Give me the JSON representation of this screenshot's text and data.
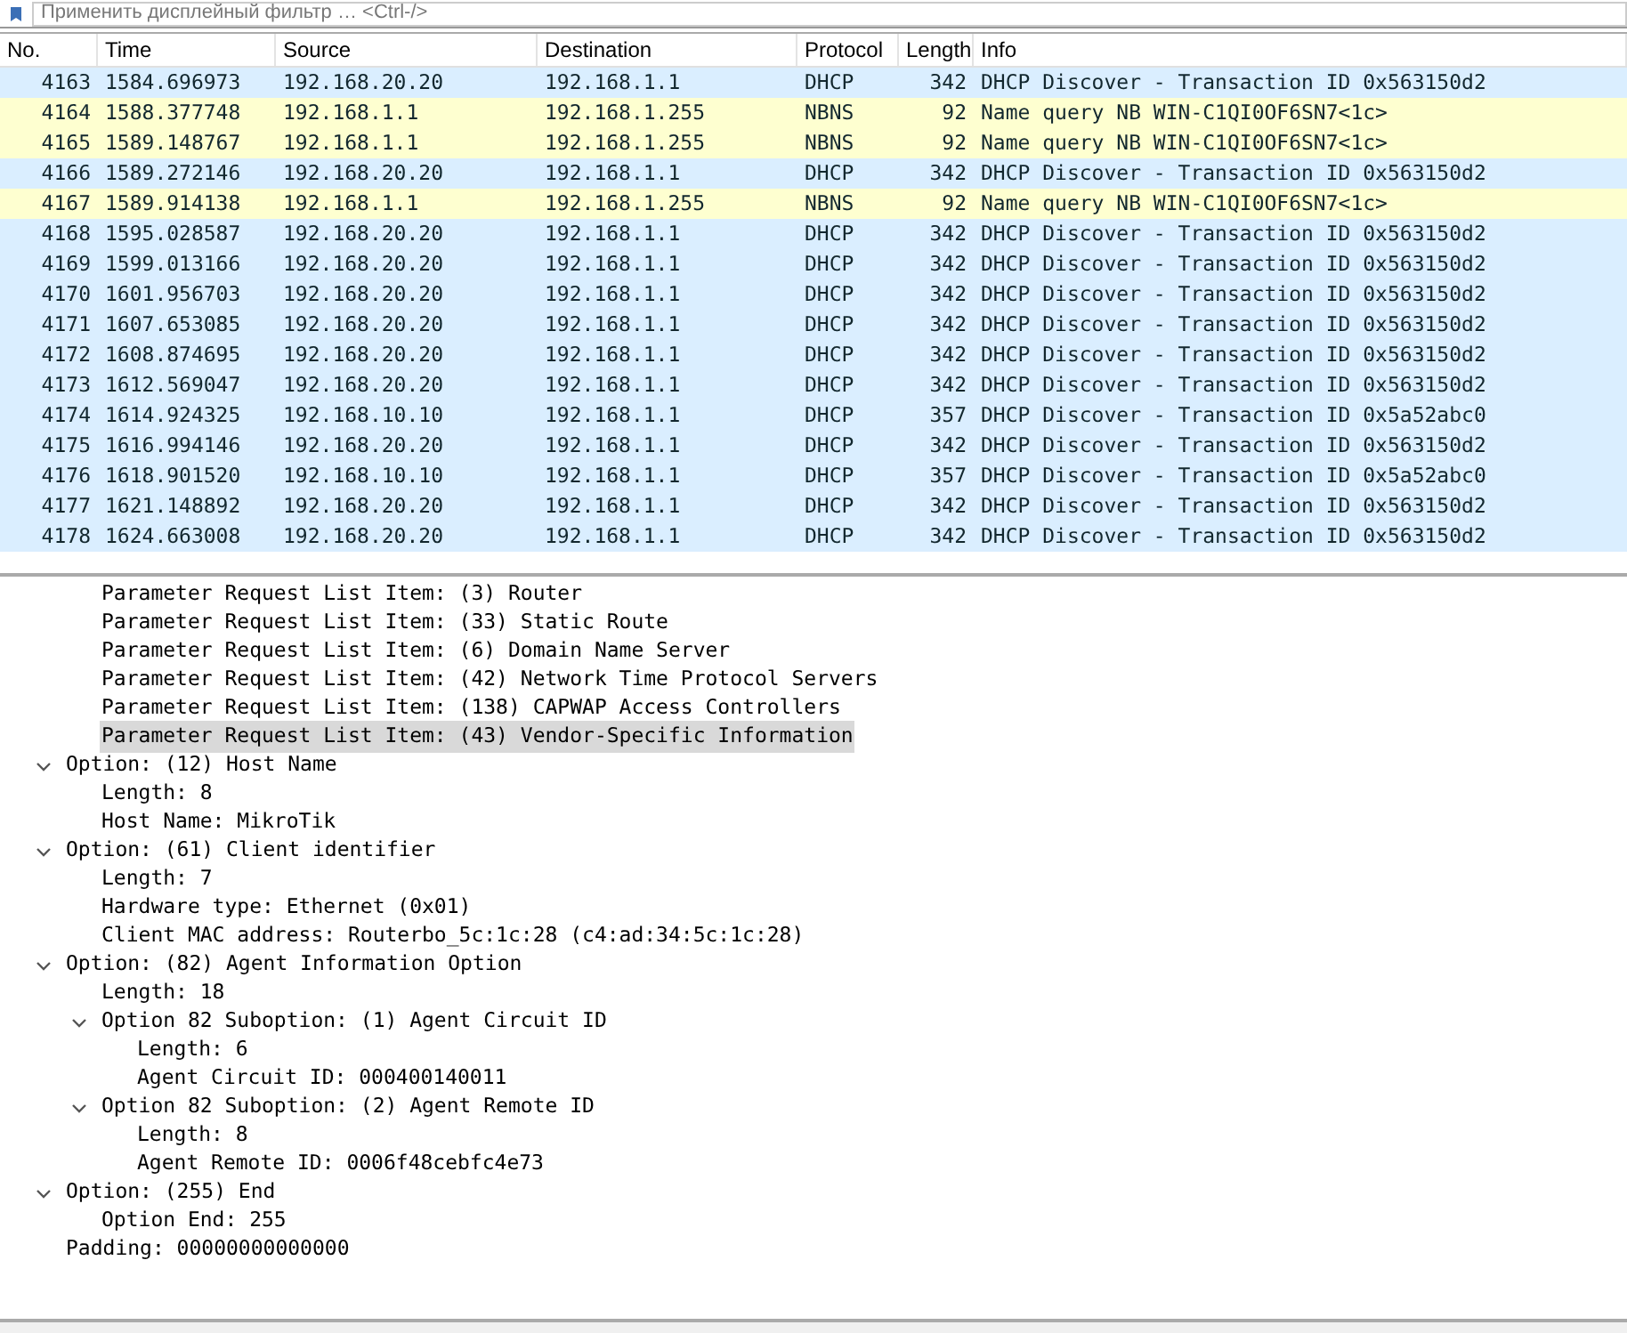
{
  "filter_bar": {
    "placeholder": "Применить дисплейный фильтр … <Ctrl-/>"
  },
  "packet_list": {
    "columns": [
      "No.",
      "Time",
      "Source",
      "Destination",
      "Protocol",
      "Length",
      "Info"
    ],
    "rows": [
      {
        "cells": [
          "4163",
          "1584.696973",
          "192.168.20.20",
          "192.168.1.1",
          "DHCP",
          "342",
          "DHCP Discover - Transaction ID 0x563150d2"
        ],
        "color": "#daeeff"
      },
      {
        "cells": [
          "4164",
          "1588.377748",
          "192.168.1.1",
          "192.168.1.255",
          "NBNS",
          "92",
          "Name query NB WIN-C1QI0OF6SN7<1c>"
        ],
        "color": "#feffd0"
      },
      {
        "cells": [
          "4165",
          "1589.148767",
          "192.168.1.1",
          "192.168.1.255",
          "NBNS",
          "92",
          "Name query NB WIN-C1QI0OF6SN7<1c>"
        ],
        "color": "#feffd0"
      },
      {
        "cells": [
          "4166",
          "1589.272146",
          "192.168.20.20",
          "192.168.1.1",
          "DHCP",
          "342",
          "DHCP Discover - Transaction ID 0x563150d2"
        ],
        "color": "#daeeff"
      },
      {
        "cells": [
          "4167",
          "1589.914138",
          "192.168.1.1",
          "192.168.1.255",
          "NBNS",
          "92",
          "Name query NB WIN-C1QI0OF6SN7<1c>"
        ],
        "color": "#feffd0"
      },
      {
        "cells": [
          "4168",
          "1595.028587",
          "192.168.20.20",
          "192.168.1.1",
          "DHCP",
          "342",
          "DHCP Discover - Transaction ID 0x563150d2"
        ],
        "color": "#daeeff"
      },
      {
        "cells": [
          "4169",
          "1599.013166",
          "192.168.20.20",
          "192.168.1.1",
          "DHCP",
          "342",
          "DHCP Discover - Transaction ID 0x563150d2"
        ],
        "color": "#daeeff"
      },
      {
        "cells": [
          "4170",
          "1601.956703",
          "192.168.20.20",
          "192.168.1.1",
          "DHCP",
          "342",
          "DHCP Discover - Transaction ID 0x563150d2"
        ],
        "color": "#daeeff"
      },
      {
        "cells": [
          "4171",
          "1607.653085",
          "192.168.20.20",
          "192.168.1.1",
          "DHCP",
          "342",
          "DHCP Discover - Transaction ID 0x563150d2"
        ],
        "color": "#daeeff"
      },
      {
        "cells": [
          "4172",
          "1608.874695",
          "192.168.20.20",
          "192.168.1.1",
          "DHCP",
          "342",
          "DHCP Discover - Transaction ID 0x563150d2"
        ],
        "color": "#daeeff"
      },
      {
        "cells": [
          "4173",
          "1612.569047",
          "192.168.20.20",
          "192.168.1.1",
          "DHCP",
          "342",
          "DHCP Discover - Transaction ID 0x563150d2"
        ],
        "color": "#daeeff"
      },
      {
        "cells": [
          "4174",
          "1614.924325",
          "192.168.10.10",
          "192.168.1.1",
          "DHCP",
          "357",
          "DHCP Discover - Transaction ID 0x5a52abc0"
        ],
        "color": "#daeeff"
      },
      {
        "cells": [
          "4175",
          "1616.994146",
          "192.168.20.20",
          "192.168.1.1",
          "DHCP",
          "342",
          "DHCP Discover - Transaction ID 0x563150d2"
        ],
        "color": "#daeeff"
      },
      {
        "cells": [
          "4176",
          "1618.901520",
          "192.168.10.10",
          "192.168.1.1",
          "DHCP",
          "357",
          "DHCP Discover - Transaction ID 0x5a52abc0"
        ],
        "color": "#daeeff"
      },
      {
        "cells": [
          "4177",
          "1621.148892",
          "192.168.20.20",
          "192.168.1.1",
          "DHCP",
          "342",
          "DHCP Discover - Transaction ID 0x563150d2"
        ],
        "color": "#daeeff"
      },
      {
        "cells": [
          "4178",
          "1624.663008",
          "192.168.20.20",
          "192.168.1.1",
          "DHCP",
          "342",
          "DHCP Discover - Transaction ID 0x563150d2"
        ],
        "color": "#daeeff"
      }
    ]
  },
  "details": [
    {
      "expanded": true,
      "children": [
        {
          "label": "Parameter Request List Item: (3) Router",
          "selected": false
        },
        {
          "label": "Parameter Request List Item: (33) Static Route",
          "selected": false
        },
        {
          "label": "Parameter Request List Item: (6) Domain Name Server",
          "selected": false
        },
        {
          "label": "Parameter Request List Item: (42) Network Time Protocol Servers",
          "selected": false
        },
        {
          "label": "Parameter Request List Item: (138) CAPWAP Access Controllers",
          "selected": false
        },
        {
          "label": "Parameter Request List Item: (43) Vendor-Specific Information",
          "selected": true
        }
      ]
    },
    {
      "label": "Option: (12) Host Name",
      "selected": false,
      "expanded": true,
      "children": [
        {
          "label": "Length: 8",
          "selected": false
        },
        {
          "label": "Host Name: MikroTik",
          "selected": false
        }
      ]
    },
    {
      "label": "Option: (61) Client identifier",
      "selected": false,
      "expanded": true,
      "children": [
        {
          "label": "Length: 7",
          "selected": false
        },
        {
          "label": "Hardware type: Ethernet (0x01)",
          "selected": false
        },
        {
          "label": "Client MAC address: Routerbo_5c:1c:28 (c4:ad:34:5c:1c:28)",
          "selected": false
        }
      ]
    },
    {
      "label": "Option: (82) Agent Information Option",
      "selected": false,
      "expanded": true,
      "children": [
        {
          "label": "Length: 18",
          "selected": false
        },
        {
          "label": "Option 82 Suboption: (1) Agent Circuit ID",
          "selected": false,
          "expanded": true,
          "children": [
            {
              "label": "Length: 6",
              "selected": false
            },
            {
              "label": "Agent Circuit ID: 000400140011",
              "selected": false
            }
          ]
        },
        {
          "label": "Option 82 Suboption: (2) Agent Remote ID",
          "selected": false,
          "expanded": true,
          "children": [
            {
              "label": "Length: 8",
              "selected": false
            },
            {
              "label": "Agent Remote ID: 0006f48cebfc4e73",
              "selected": false
            }
          ]
        }
      ]
    },
    {
      "label": "Option: (255) End",
      "selected": false,
      "expanded": true,
      "children": [
        {
          "label": "Option End: 255",
          "selected": false
        }
      ]
    },
    {
      "label": "Padding: 00000000000000",
      "selected": false
    }
  ]
}
